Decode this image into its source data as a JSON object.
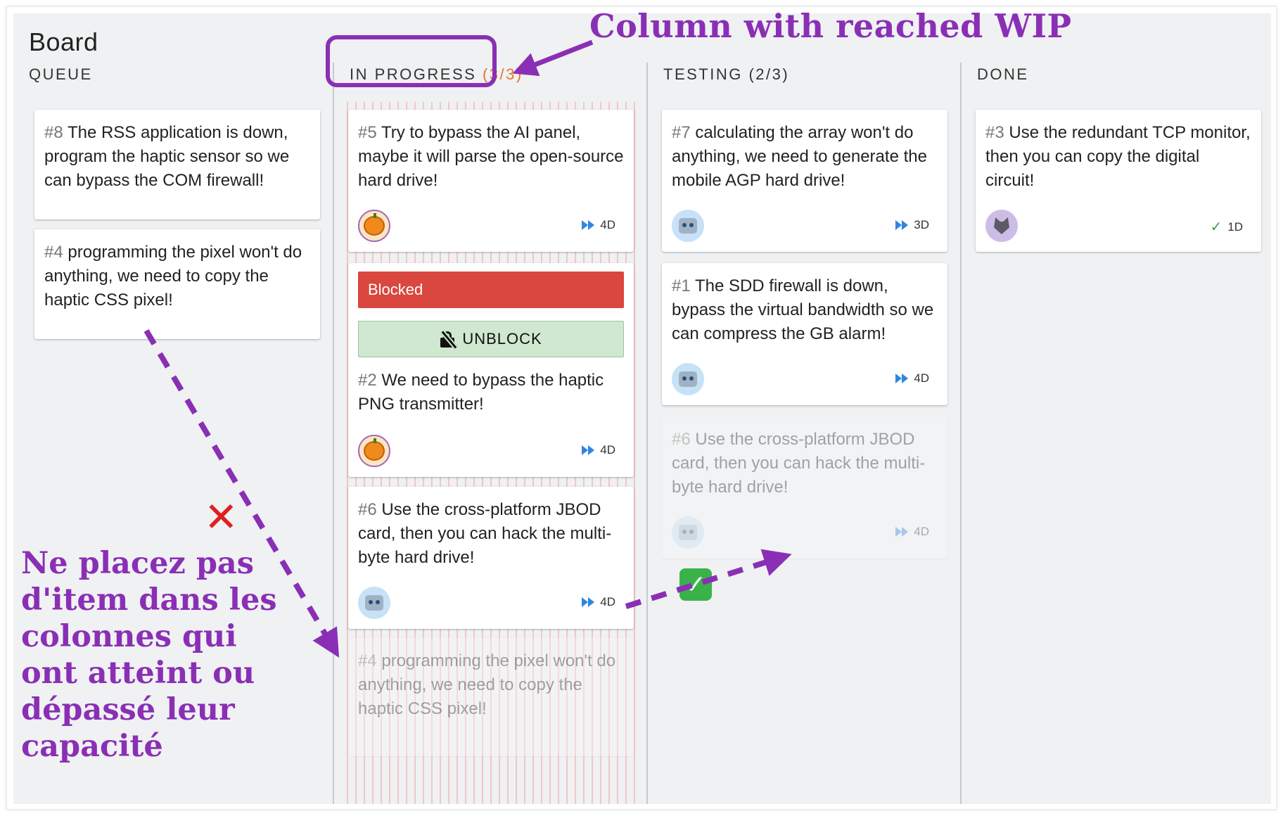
{
  "board": {
    "title": "Board"
  },
  "columns": [
    {
      "name": "QUEUE",
      "count": ""
    },
    {
      "name": "IN PROGRESS",
      "count": "(3/3)"
    },
    {
      "name": "TESTING",
      "count": "(2/3)"
    },
    {
      "name": "DONE",
      "count": ""
    }
  ],
  "queue": {
    "cards": [
      {
        "num": "#8",
        "text": "The RSS application is down, program the haptic sensor so we can bypass the COM firewall!"
      },
      {
        "num": "#4",
        "text": "programming the pixel won't do anything, we need to copy the haptic CSS pixel!"
      }
    ]
  },
  "in_progress": {
    "cards": [
      {
        "num": "#5",
        "text": "Try to bypass the AI panel, maybe it will parse the open-source hard drive!",
        "age": "4D",
        "avatar": "pumpkin-icon"
      },
      {
        "num": "#2",
        "text": "We need to bypass the haptic PNG transmitter!",
        "age": "4D",
        "avatar": "pumpkin-icon",
        "blocked_label": "Blocked",
        "unblock_label": "UNBLOCK"
      },
      {
        "num": "#6",
        "text": "Use the cross-platform JBOD card, then you can hack the multi-byte hard drive!",
        "age": "4D",
        "avatar": "robot-icon"
      }
    ],
    "ghost": {
      "num": "#4",
      "text": "programming the pixel won't do anything, we need to copy the haptic CSS pixel!"
    }
  },
  "testing": {
    "cards": [
      {
        "num": "#7",
        "text": "calculating the array won't do anything, we need to generate the mobile AGP hard drive!",
        "age": "3D",
        "avatar": "robot-icon"
      },
      {
        "num": "#1",
        "text": "The SDD firewall is down, bypass the virtual bandwidth so we can compress the GB alarm!",
        "age": "4D",
        "avatar": "robot-icon"
      }
    ],
    "ghost": {
      "num": "#6",
      "text": "Use the cross-platform JBOD card, then you can hack the multi-byte hard drive!",
      "age": "4D"
    }
  },
  "done": {
    "cards": [
      {
        "num": "#3",
        "text": "Use the redundant TCP monitor, then you can copy the digital circuit!",
        "age": "1D",
        "avatar": "wolf-icon"
      }
    ]
  },
  "annotations": {
    "title": "Column with reached WIP",
    "note": "Ne placez pas d'item dans les colonnes qui ont atteint ou dépassé leur capacité"
  },
  "colors": {
    "annotation": "#8a2fb5",
    "wip_count": "#e8742a",
    "blocked": "#d9473f",
    "unblock": "#cfe8cf",
    "age_icon": "#2f86e0"
  }
}
